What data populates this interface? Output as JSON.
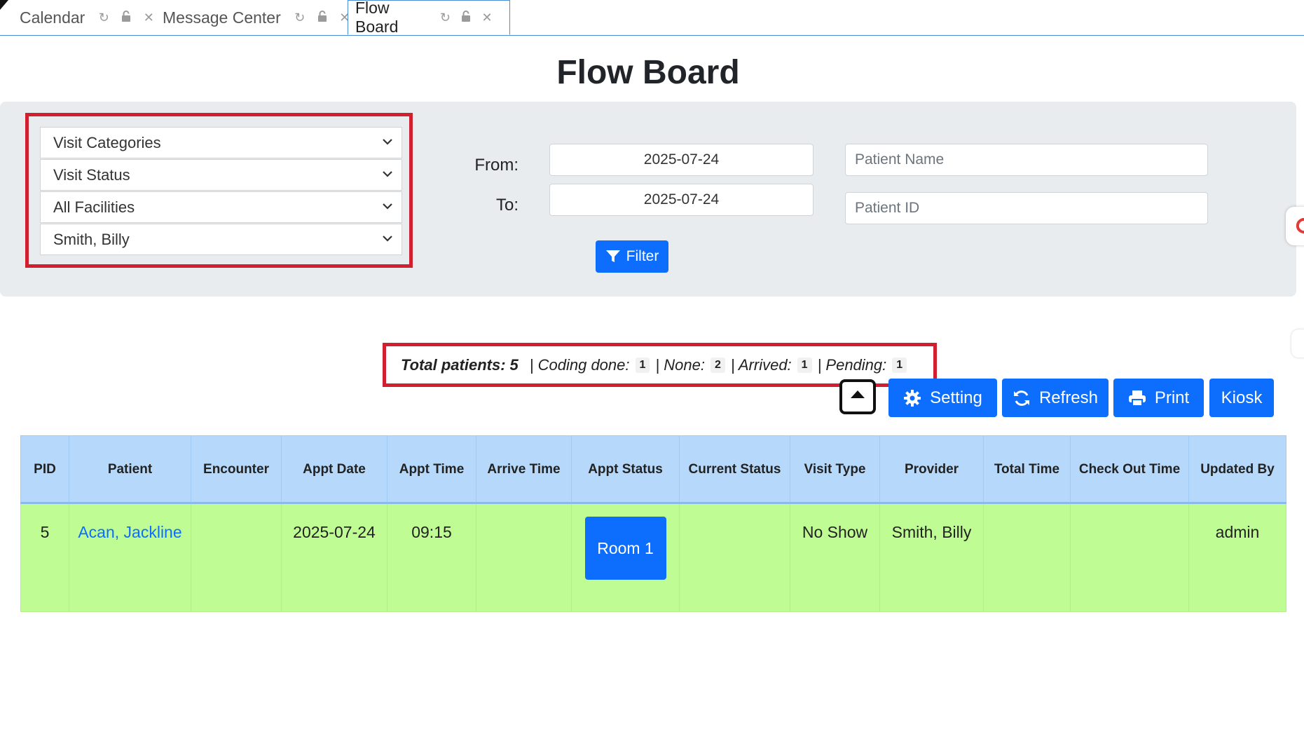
{
  "tabs": [
    {
      "label": "Calendar",
      "active": false
    },
    {
      "label": "Message Center",
      "active": false
    },
    {
      "label": "Flow Board",
      "active": true
    }
  ],
  "page_title": "Flow Board",
  "filters": {
    "visit_categories": "Visit Categories",
    "visit_status": "Visit Status",
    "facilities": "All Facilities",
    "provider": "Smith, Billy",
    "from_label": "From:",
    "to_label": "To:",
    "from_date": "2025-07-24",
    "to_date": "2025-07-24",
    "patient_name_placeholder": "Patient Name",
    "patient_id_placeholder": "Patient ID",
    "filter_button": "Filter"
  },
  "summary": {
    "total_label": "Total patients:",
    "total_value": "5",
    "coding_done_label": "| Coding done:",
    "coding_done_value": "1",
    "none_label": "| None:",
    "none_value": "2",
    "arrived_label": "| Arrived:",
    "arrived_value": "1",
    "pending_label": "| Pending:",
    "pending_value": "1"
  },
  "actions": {
    "setting": "Setting",
    "refresh": "Refresh",
    "print": "Print",
    "kiosk": "Kiosk"
  },
  "table": {
    "headers": [
      "PID",
      "Patient",
      "Encounter",
      "Appt Date",
      "Appt Time",
      "Arrive Time",
      "Appt Status",
      "Current Status",
      "Visit Type",
      "Provider",
      "Total Time",
      "Check Out Time",
      "Updated By"
    ],
    "rows": [
      {
        "pid": "5",
        "patient": "Acan, Jackline",
        "encounter": "",
        "appt_date": "2025-07-24",
        "appt_time": "09:15",
        "arrive_time": "",
        "appt_status": "Room 1",
        "current_status": "",
        "visit_type": "No Show",
        "provider": "Smith, Billy",
        "total_time": "",
        "check_out_time": "",
        "updated_by": "admin"
      }
    ]
  },
  "colors": {
    "primary": "#0d6efd",
    "highlight_box": "#d01f2f",
    "table_header": "#b6d9fb",
    "row_background": "#c0fc94",
    "filter_panel": "#e9ecef"
  }
}
